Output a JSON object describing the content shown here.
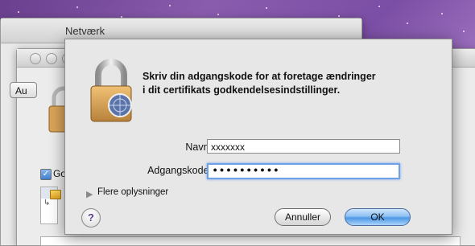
{
  "background_window": {
    "title": "Netværk"
  },
  "middle_window": {
    "partial_button_label": "Au",
    "checkbox_label": "Go",
    "list_item_symbol": "↳"
  },
  "dialog": {
    "message_line1": "Skriv din adgangskode for at foretage ændringer",
    "message_line2": "i dit certifikats godkendelsesindstillinger.",
    "name_label": "Navn:",
    "name_value": "xxxxxxx",
    "password_label": "Adgangskode:",
    "password_value": "••••••••••",
    "details_label": "Flere oplysninger",
    "help_label": "?",
    "cancel_label": "Annuller",
    "ok_label": "OK"
  },
  "icons": {
    "lock": "padlock-icon",
    "help": "help-icon",
    "disclosure": "disclosure-triangle-icon"
  },
  "colors": {
    "desktop": "#7b4ea5",
    "focus_ring": "#6ea1e8",
    "default_button": "#4d98e5"
  }
}
